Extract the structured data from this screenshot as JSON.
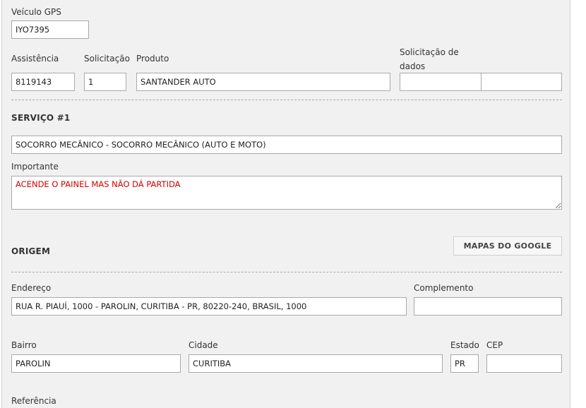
{
  "vehicle": {
    "gps_label": "Veículo GPS",
    "gps_value": "IYO7395"
  },
  "request": {
    "assistencia_label": "Assistência",
    "assistencia_value": "8119143",
    "solicitacao_label": "Solicitação",
    "solicitacao_value": "1",
    "produto_label": "Produto",
    "produto_value": "SANTANDER AUTO",
    "solicitacao_dados_label": "Solicitação de dados",
    "solicitacao_dados_value1": "",
    "solicitacao_dados_value2": ""
  },
  "servico": {
    "title": "SERVIÇO #1",
    "service_value": "SOCORRO MECÂNICO - SOCORRO MECÂNICO (AUTO E MOTO)",
    "importante_label": "Importante",
    "importante_value": "ACENDE O PAINEL MAS NÃO DÁ PARTIDA"
  },
  "origem": {
    "title": "ORIGEM",
    "maps_button": "MAPAS DO GOOGLE",
    "endereco_label": "Endereço",
    "endereco_value": "RUA R. PIAUÍ, 1000 - PAROLIN, CURITIBA - PR, 80220-240, BRASIL, 1000",
    "complemento_label": "Complemento",
    "complemento_value": "",
    "bairro_label": "Bairro",
    "bairro_value": "PAROLIN",
    "cidade_label": "Cidade",
    "cidade_value": "CURITIBA",
    "estado_label": "Estado",
    "estado_value": "PR",
    "cep_label": "CEP",
    "cep_value": "",
    "referencia_label": "Referência"
  }
}
